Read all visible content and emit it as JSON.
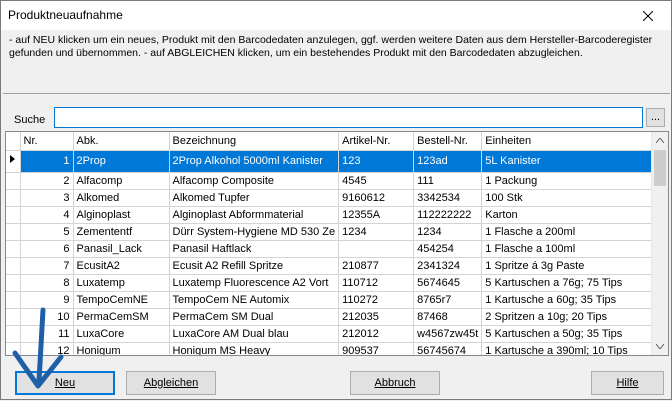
{
  "window": {
    "title": "Produktneuaufnahme"
  },
  "info": {
    "text": "- auf NEU klicken um ein neues, Produkt mit den Barcodedaten anzulegen, ggf. werden weitere Daten aus dem Hersteller-Barcoderegister gefunden und übernommen. - auf ABGLEICHEN klicken, um ein bestehendes Produkt mit den Barcodedaten abzugleichen."
  },
  "search": {
    "label": "Suche",
    "value": "",
    "browse_label": "..."
  },
  "grid": {
    "columns": [
      "Nr.",
      "Abk.",
      "Bezeichnung",
      "Artikel-Nr.",
      "Bestell-Nr.",
      "Einheiten"
    ],
    "selected_row": 0,
    "rows": [
      [
        "1",
        "2Prop",
        "2Prop Alkohol 5000ml Kanister",
        "123",
        "123ad",
        "5L Kanister"
      ],
      [
        "2",
        "Alfacomp",
        "Alfacomp Composite",
        "4545",
        "111",
        "1 Packung"
      ],
      [
        "3",
        "Alkomed",
        "Alkomed Tupfer",
        "9160612",
        "3342534",
        "100 Stk"
      ],
      [
        "4",
        "Alginoplast",
        "Alginoplast Abformmaterial",
        "12355A",
        "112222222",
        "Karton"
      ],
      [
        "5",
        "Zemententf",
        "Dürr System-Hygiene MD 530 Ze",
        "1234",
        "1234",
        "1 Flasche a 200ml"
      ],
      [
        "6",
        "Panasil_Lack",
        "Panasil Haftlack",
        "",
        "454254",
        "1 Flasche a 100ml"
      ],
      [
        "7",
        "EcusitA2",
        "Ecusit A2 Refill Spritze",
        "210877",
        "2341324",
        "1 Spritze á 3g Paste"
      ],
      [
        "8",
        "Luxatemp",
        "Luxatemp Fluorescence A2 Vort",
        "110712",
        "5674645",
        "5 Kartuschen a 76g; 75 Tips"
      ],
      [
        "9",
        "TempoCemNE",
        "TempoCem NE Automix",
        "110272",
        "8765r7",
        "1 Kartusche a 60g; 35 Tips"
      ],
      [
        "10",
        "PermaCemSM",
        "PermaCem SM Dual",
        "212035",
        "87468",
        "2 Spritzen a 10g; 20 Tips"
      ],
      [
        "11",
        "LuxaCore",
        "LuxaCore AM Dual blau",
        "212012",
        "w4567zw45t",
        "5 Kartuschen a 50g; 35 Tips"
      ],
      [
        "12",
        "Honigum",
        "Honigum MS Heavy",
        "909537",
        "56745674",
        "1 Kartusche a 390ml; 10 Tips"
      ]
    ]
  },
  "buttons": {
    "new": "Neu",
    "match": "Abgleichen",
    "cancel": "Abbruch",
    "help": "Hilfe"
  },
  "colors": {
    "selection": "#0078d7",
    "annotation_arrow": "#1f5fa8"
  }
}
